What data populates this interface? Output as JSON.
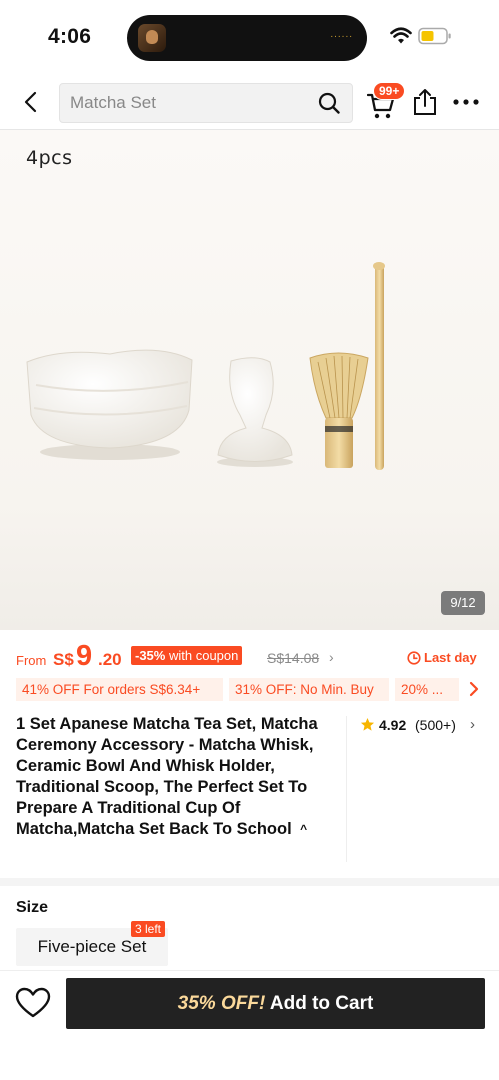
{
  "status_bar": {
    "time": "4:06",
    "island_dots": "......"
  },
  "search": {
    "placeholder": "Matcha Set",
    "value": ""
  },
  "header": {
    "cart_badge": "99+"
  },
  "gallery": {
    "caption": "4pcs",
    "counter": "9/12"
  },
  "price": {
    "from_label": "From",
    "currency": "S$",
    "main": "9",
    "cents": ".20",
    "discount_percent": "-35%",
    "discount_note": "with coupon",
    "original": "S$14.08",
    "chevron": "›",
    "last_day": "Last day"
  },
  "coupons": [
    "41% OFF For orders S$6.34+",
    "31% OFF: No Min. Buy",
    "20% ..."
  ],
  "product": {
    "title": "1 Set Apanese Matcha Tea Set, Matcha Ceremony Accessory - Matcha Whisk, Ceramic Bowl And Whisk Holder, Traditional Scoop, The Perfect Set To Prepare A Traditional Cup Of Matcha,Matcha Set Back To School",
    "collapse_glyph": "^",
    "rating": "4.92",
    "review_count": "(500+)",
    "rating_chevron": "›"
  },
  "size": {
    "label": "Size",
    "option": "Five-piece Set",
    "stock_badge": "3 left"
  },
  "bottom_bar": {
    "promo": "35% OFF!",
    "add_to_cart": "Add to Cart"
  },
  "colors": {
    "accent": "#fa4b22",
    "coupon_bg": "#fff1ea",
    "cta_bg": "#222222",
    "promo_text": "#fbd99b",
    "star": "#f7b500"
  }
}
